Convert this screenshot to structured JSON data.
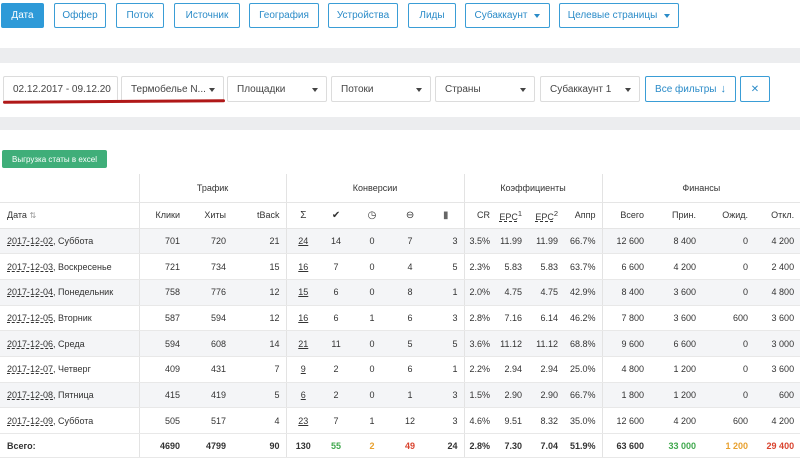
{
  "tabs": [
    {
      "label": "Дата",
      "active": true
    },
    {
      "label": "Оффер"
    },
    {
      "label": "Поток"
    },
    {
      "label": "Источник"
    },
    {
      "label": "География"
    },
    {
      "label": "Устройства"
    },
    {
      "label": "Лиды"
    },
    {
      "label": "Субаккаунт",
      "dropdown": true
    },
    {
      "label": "Целевые страницы",
      "dropdown": true
    }
  ],
  "filters": {
    "date_range": "02.12.2017 - 09.12.20",
    "offer": "Термобелье N...",
    "platforms": "Площадки",
    "streams": "Потоки",
    "countries": "Страны",
    "subaccount": "Субаккаунт 1",
    "all_filters": "Все фильтры",
    "all_filters_icon": "arrow-down-icon",
    "clear": "✕"
  },
  "excel_button": "Выгрузка статы в excel",
  "groups": {
    "traffic": "Трафик",
    "conversions": "Конверсии",
    "coefficients": "Коэффициенты",
    "finance": "Финансы"
  },
  "columns": {
    "date": "Дата",
    "clicks": "Клики",
    "hits": "Хиты",
    "tback": "tBack",
    "cr": "CR",
    "epc1": "EPC",
    "epc1_sup": "1",
    "epc2": "EPC",
    "epc2_sup": "2",
    "appr": "Аппр",
    "total": "Всего",
    "accepted": "Прин.",
    "pending": "Ожид.",
    "rejected": "Откл."
  },
  "rows": [
    {
      "date": "2017-12-02",
      "day": ", Суббота",
      "clicks": "701",
      "hits": "720",
      "tback": "21",
      "sum": "24",
      "ok": "14",
      "wait": "0",
      "rej": "7",
      "trash": "3",
      "cr": "3.5%",
      "epc1": "11.99",
      "epc2": "11.99",
      "appr": "66.7%",
      "total": "12 600",
      "accepted": "8 400",
      "pending": "0",
      "rejected": "4 200"
    },
    {
      "date": "2017-12-03",
      "day": ", Воскресенье",
      "clicks": "721",
      "hits": "734",
      "tback": "15",
      "sum": "16",
      "ok": "7",
      "wait": "0",
      "rej": "4",
      "trash": "5",
      "cr": "2.3%",
      "epc1": "5.83",
      "epc2": "5.83",
      "appr": "63.7%",
      "total": "6 600",
      "accepted": "4 200",
      "pending": "0",
      "rejected": "2 400"
    },
    {
      "date": "2017-12-04",
      "day": ", Понедельник",
      "clicks": "758",
      "hits": "776",
      "tback": "12",
      "sum": "15",
      "ok": "6",
      "wait": "0",
      "rej": "8",
      "trash": "1",
      "cr": "2.0%",
      "epc1": "4.75",
      "epc2": "4.75",
      "appr": "42.9%",
      "total": "8 400",
      "accepted": "3 600",
      "pending": "0",
      "rejected": "4 800"
    },
    {
      "date": "2017-12-05",
      "day": ", Вторник",
      "clicks": "587",
      "hits": "594",
      "tback": "12",
      "sum": "16",
      "ok": "6",
      "wait": "1",
      "rej": "6",
      "trash": "3",
      "cr": "2.8%",
      "epc1": "7.16",
      "epc2": "6.14",
      "appr": "46.2%",
      "total": "7 800",
      "accepted": "3 600",
      "pending": "600",
      "rejected": "3 600"
    },
    {
      "date": "2017-12-06",
      "day": ", Среда",
      "clicks": "594",
      "hits": "608",
      "tback": "14",
      "sum": "21",
      "ok": "11",
      "wait": "0",
      "rej": "5",
      "trash": "5",
      "cr": "3.6%",
      "epc1": "11.12",
      "epc2": "11.12",
      "appr": "68.8%",
      "total": "9 600",
      "accepted": "6 600",
      "pending": "0",
      "rejected": "3 000"
    },
    {
      "date": "2017-12-07",
      "day": ", Четверг",
      "clicks": "409",
      "hits": "431",
      "tback": "7",
      "sum": "9",
      "ok": "2",
      "wait": "0",
      "rej": "6",
      "trash": "1",
      "cr": "2.2%",
      "epc1": "2.94",
      "epc2": "2.94",
      "appr": "25.0%",
      "total": "4 800",
      "accepted": "1 200",
      "pending": "0",
      "rejected": "3 600"
    },
    {
      "date": "2017-12-08",
      "day": ", Пятница",
      "clicks": "415",
      "hits": "419",
      "tback": "5",
      "sum": "6",
      "ok": "2",
      "wait": "0",
      "rej": "1",
      "trash": "3",
      "cr": "1.5%",
      "epc1": "2.90",
      "epc2": "2.90",
      "appr": "66.7%",
      "total": "1 800",
      "accepted": "1 200",
      "pending": "0",
      "rejected": "600"
    },
    {
      "date": "2017-12-09",
      "day": ", Суббота",
      "clicks": "505",
      "hits": "517",
      "tback": "4",
      "sum": "23",
      "ok": "7",
      "wait": "1",
      "rej": "12",
      "trash": "3",
      "cr": "4.6%",
      "epc1": "9.51",
      "epc2": "8.32",
      "appr": "35.0%",
      "total": "12 600",
      "accepted": "4 200",
      "pending": "600",
      "rejected": "4 200"
    }
  ],
  "totals": {
    "label": "Всего:",
    "clicks": "4690",
    "hits": "4799",
    "tback": "90",
    "sum": "130",
    "ok": "55",
    "wait": "2",
    "rej": "49",
    "trash": "24",
    "cr": "2.8%",
    "epc1": "7.30",
    "epc2": "7.04",
    "appr": "51.9%",
    "total": "63 600",
    "accepted": "33 000",
    "pending": "1 200",
    "rejected": "29 400"
  },
  "colors": {
    "accent": "#2e9ad8",
    "excel": "#3fae79",
    "ok": "#3fa84d",
    "pending": "#e8a02e",
    "rejected": "#d9432e",
    "annotation": "#b01818"
  }
}
